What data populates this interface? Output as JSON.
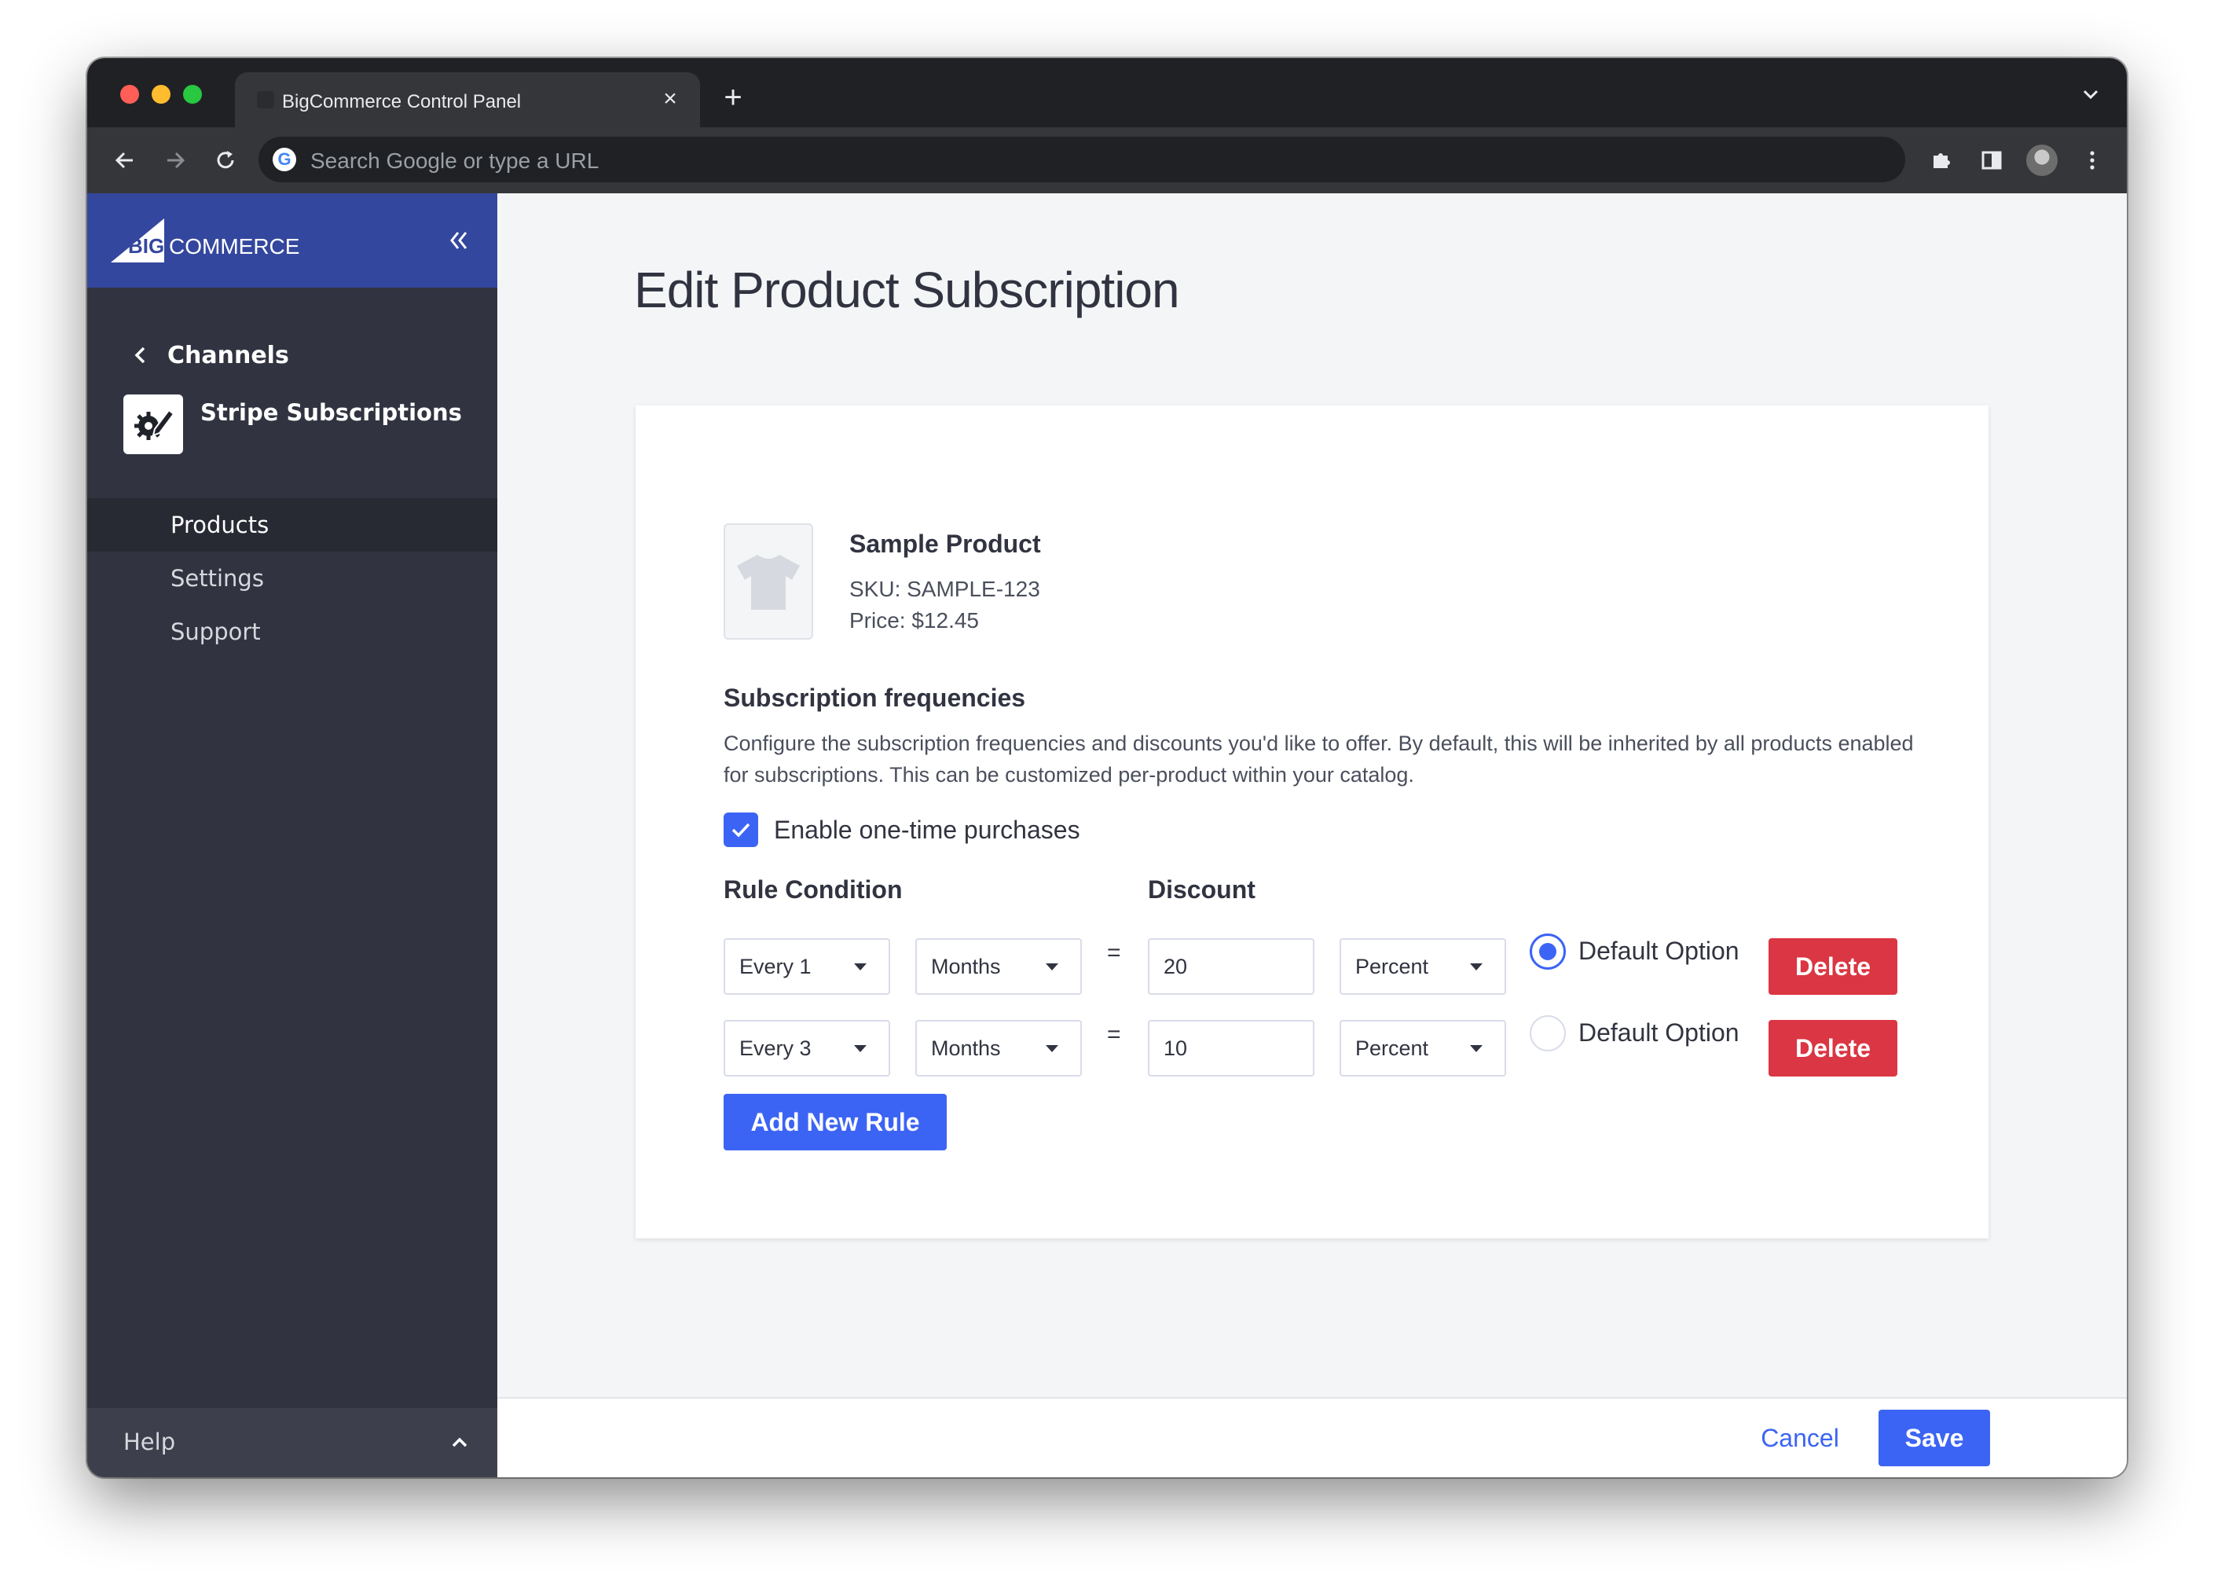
{
  "browser": {
    "tab_title": "BigCommerce Control Panel",
    "omnibox_placeholder": "Search Google or type a URL",
    "icons": [
      "back-arrow-icon",
      "forward-arrow-icon",
      "reload-icon",
      "google-icon",
      "extensions-puzzle-icon",
      "side-panel-icon",
      "profile-avatar",
      "kebab-menu-icon"
    ]
  },
  "sidebar": {
    "brand_prefix": "BIG",
    "brand_suffix": "COMMERCE",
    "back_label": "Channels",
    "app_name": "Stripe Subscriptions",
    "items": [
      {
        "label": "Products",
        "active": true
      },
      {
        "label": "Settings",
        "active": false
      },
      {
        "label": "Support",
        "active": false
      }
    ],
    "help_label": "Help"
  },
  "page": {
    "title": "Edit Product Subscription"
  },
  "product": {
    "name": "Sample Product",
    "sku": "SKU: SAMPLE-123",
    "price": "Price: $12.45"
  },
  "subscription": {
    "title": "Subscription frequencies",
    "description": "Configure the subscription frequencies and discounts you'd like to offer. By default, this will be inherited by all products enabled for subscriptions. This can be customized per-product within your catalog.",
    "one_time_label": "Enable one-time purchases",
    "one_time_checked": true,
    "rule_header": "Rule Condition",
    "discount_header": "Discount",
    "equals": "=",
    "rules": [
      {
        "every": "Every 1",
        "unit": "Months",
        "discount": "20",
        "type": "Percent",
        "default_label": "Default Option",
        "is_default": true,
        "delete_label": "Delete"
      },
      {
        "every": "Every 3",
        "unit": "Months",
        "discount": "10",
        "type": "Percent",
        "default_label": "Default Option",
        "is_default": false,
        "delete_label": "Delete"
      }
    ],
    "add_rule_label": "Add New Rule"
  },
  "footer": {
    "cancel_label": "Cancel",
    "save_label": "Save"
  },
  "colors": {
    "brand": "#34479e",
    "sidebar": "#313440",
    "primary": "#3c64f4",
    "danger": "#db3643"
  }
}
